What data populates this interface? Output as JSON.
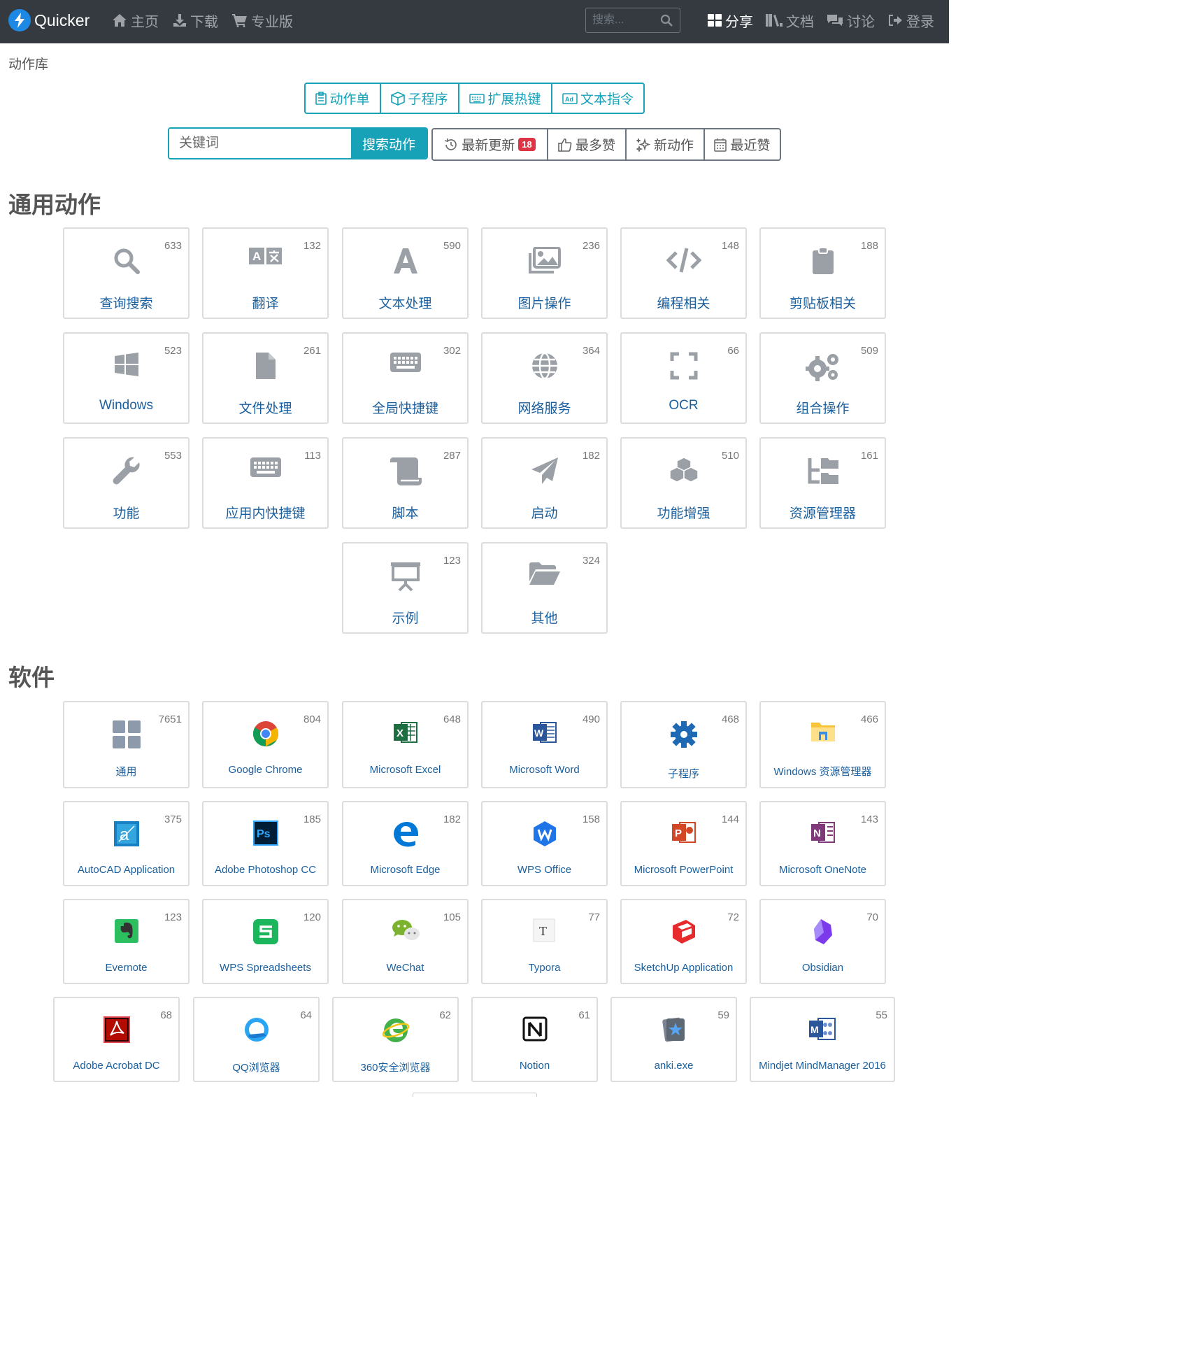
{
  "navbar": {
    "brand": "Quicker",
    "nav": [
      {
        "label": "主页",
        "icon": "home-icon"
      },
      {
        "label": "下载",
        "icon": "download-icon"
      },
      {
        "label": "专业版",
        "icon": "cart-icon"
      }
    ],
    "search_placeholder": "搜索...",
    "right": [
      {
        "label": "分享",
        "icon": "grid-icon"
      },
      {
        "label": "文档",
        "icon": "book-icon"
      },
      {
        "label": "讨论",
        "icon": "comments-icon"
      },
      {
        "label": "登录",
        "icon": "sign-in-icon"
      }
    ]
  },
  "breadcrumb": "动作库",
  "type_tabs": [
    {
      "label": "动作单",
      "icon": "clipboard-list-icon"
    },
    {
      "label": "子程序",
      "icon": "cube-icon"
    },
    {
      "label": "扩展热键",
      "icon": "keyboard-icon"
    },
    {
      "label": "文本指令",
      "icon": "ad-icon"
    }
  ],
  "search": {
    "placeholder": "关键词",
    "button": "搜索动作"
  },
  "sort_tabs": [
    {
      "label": "最新更新",
      "icon": "history-icon",
      "badge": "18"
    },
    {
      "label": "最多赞",
      "icon": "thumbs-up-icon"
    },
    {
      "label": "新动作",
      "icon": "sparkles-icon"
    },
    {
      "label": "最近赞",
      "icon": "calendar-icon"
    }
  ],
  "sections": {
    "general": {
      "title": "通用动作",
      "items": [
        {
          "label": "查询搜索",
          "count": "633",
          "icon": "search-icon"
        },
        {
          "label": "翻译",
          "count": "132",
          "icon": "translate-icon"
        },
        {
          "label": "文本处理",
          "count": "590",
          "icon": "font-icon"
        },
        {
          "label": "图片操作",
          "count": "236",
          "icon": "images-icon"
        },
        {
          "label": "编程相关",
          "count": "148",
          "icon": "code-icon"
        },
        {
          "label": "剪贴板相关",
          "count": "188",
          "icon": "clipboard-icon"
        },
        {
          "label": "Windows",
          "count": "523",
          "icon": "windows-icon"
        },
        {
          "label": "文件处理",
          "count": "261",
          "icon": "file-icon"
        },
        {
          "label": "全局快捷键",
          "count": "302",
          "icon": "keyboard-icon"
        },
        {
          "label": "网络服务",
          "count": "364",
          "icon": "globe-icon"
        },
        {
          "label": "OCR",
          "count": "66",
          "icon": "scan-icon"
        },
        {
          "label": "组合操作",
          "count": "509",
          "icon": "cogs-icon"
        },
        {
          "label": "功能",
          "count": "553",
          "icon": "wrench-icon"
        },
        {
          "label": "应用内快捷键",
          "count": "113",
          "icon": "keyboard-icon"
        },
        {
          "label": "脚本",
          "count": "287",
          "icon": "scroll-icon"
        },
        {
          "label": "启动",
          "count": "182",
          "icon": "paper-plane-icon"
        },
        {
          "label": "功能增强",
          "count": "510",
          "icon": "cubes-icon"
        },
        {
          "label": "资源管理器",
          "count": "161",
          "icon": "folder-tree-icon"
        },
        {
          "label": "示例",
          "count": "123",
          "icon": "presentation-icon"
        },
        {
          "label": "其他",
          "count": "324",
          "icon": "folder-open-icon"
        }
      ]
    },
    "software": {
      "title": "软件",
      "items": [
        {
          "label": "通用",
          "count": "7651",
          "icon": "grid-icon"
        },
        {
          "label": "Google Chrome",
          "count": "804",
          "icon": "chrome-icon"
        },
        {
          "label": "Microsoft Excel",
          "count": "648",
          "icon": "excel-icon"
        },
        {
          "label": "Microsoft Word",
          "count": "490",
          "icon": "word-icon"
        },
        {
          "label": "子程序",
          "count": "468",
          "icon": "gear-icon"
        },
        {
          "label": "Windows 资源管理器",
          "count": "466",
          "icon": "explorer-icon"
        },
        {
          "label": "AutoCAD Application",
          "count": "375",
          "icon": "autocad-icon"
        },
        {
          "label": "Adobe Photoshop CC",
          "count": "185",
          "icon": "photoshop-icon"
        },
        {
          "label": "Microsoft Edge",
          "count": "182",
          "icon": "edge-icon"
        },
        {
          "label": "WPS Office",
          "count": "158",
          "icon": "wps-office-icon"
        },
        {
          "label": "Microsoft PowerPoint",
          "count": "144",
          "icon": "powerpoint-icon"
        },
        {
          "label": "Microsoft OneNote",
          "count": "143",
          "icon": "onenote-icon"
        },
        {
          "label": "Evernote",
          "count": "123",
          "icon": "evernote-icon"
        },
        {
          "label": "WPS Spreadsheets",
          "count": "120",
          "icon": "wps-sheets-icon"
        },
        {
          "label": "WeChat",
          "count": "105",
          "icon": "wechat-icon"
        },
        {
          "label": "Typora",
          "count": "77",
          "icon": "typora-icon"
        },
        {
          "label": "SketchUp Application",
          "count": "72",
          "icon": "sketchup-icon"
        },
        {
          "label": "Obsidian",
          "count": "70",
          "icon": "obsidian-icon"
        },
        {
          "label": "Adobe Acrobat DC",
          "count": "68",
          "icon": "acrobat-icon"
        },
        {
          "label": "QQ浏览器",
          "count": "64",
          "icon": "qq-browser-icon"
        },
        {
          "label": "360安全浏览器",
          "count": "62",
          "icon": "360-browser-icon"
        },
        {
          "label": "Notion",
          "count": "61",
          "icon": "notion-icon"
        },
        {
          "label": "anki.exe",
          "count": "59",
          "icon": "anki-icon"
        },
        {
          "label": "Mindjet MindManager 2016",
          "count": "55",
          "icon": "mindmanager-icon"
        }
      ]
    }
  }
}
